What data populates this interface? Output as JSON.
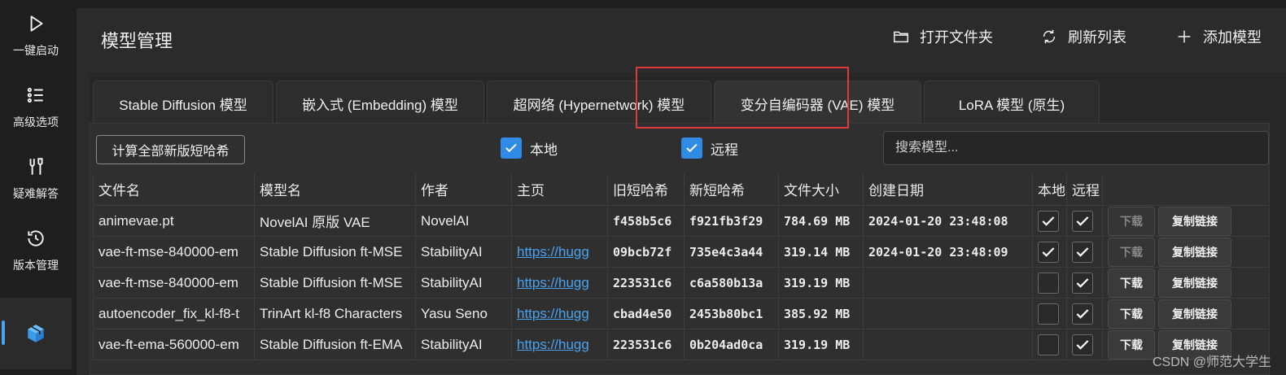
{
  "sidebar": {
    "items": [
      {
        "label": "一键启动",
        "icon": "play-icon"
      },
      {
        "label": "高级选项",
        "icon": "list-icon"
      },
      {
        "label": "疑难解答",
        "icon": "tools-icon"
      },
      {
        "label": "版本管理",
        "icon": "history-icon"
      },
      {
        "label": "",
        "icon": "cube-icon",
        "active": true
      }
    ]
  },
  "header": {
    "title": "模型管理",
    "open_folder": "打开文件夹",
    "refresh": "刷新列表",
    "add_model": "添加模型"
  },
  "tabs": [
    {
      "label": "Stable Diffusion 模型"
    },
    {
      "label": "嵌入式 (Embedding) 模型"
    },
    {
      "label": "超网络 (Hypernetwork) 模型"
    },
    {
      "label": "变分自编码器 (VAE) 模型",
      "active": true
    },
    {
      "label": "LoRA 模型 (原生)"
    }
  ],
  "toolbar": {
    "calc_button": "计算全部新版短哈希",
    "filter_local": "本地",
    "filter_remote": "远程",
    "search_placeholder": "搜索模型..."
  },
  "table": {
    "headers": [
      "文件名",
      "模型名",
      "作者",
      "主页",
      "旧短哈希",
      "新短哈希",
      "文件大小",
      "创建日期",
      "本地",
      "远程",
      ""
    ],
    "rows": [
      {
        "file": "animevae.pt",
        "model": "NovelAI 原版 VAE",
        "author": "NovelAI",
        "home": "",
        "old_hash": "f458b5c6",
        "new_hash": "f921fb3f29",
        "size": "784.69 MB",
        "date": "2024-01-20 23:48:08",
        "local": true,
        "remote": true,
        "download": "下载",
        "download_disabled": true,
        "copy": "复制链接"
      },
      {
        "file": "vae-ft-mse-840000-em",
        "model": "Stable Diffusion ft-MSE",
        "author": "StabilityAI",
        "home": "https://hugg",
        "old_hash": "09bcb72f",
        "new_hash": "735e4c3a44",
        "size": "319.14 MB",
        "date": "2024-01-20 23:48:09",
        "local": true,
        "remote": true,
        "download": "下载",
        "download_disabled": true,
        "copy": "复制链接"
      },
      {
        "file": "vae-ft-mse-840000-em",
        "model": "Stable Diffusion ft-MSE",
        "author": "StabilityAI",
        "home": "https://hugg",
        "old_hash": "223531c6",
        "new_hash": "c6a580b13a",
        "size": "319.19 MB",
        "date": "",
        "local": false,
        "remote": true,
        "download": "下载",
        "download_disabled": false,
        "copy": "复制链接"
      },
      {
        "file": "autoencoder_fix_kl-f8-t",
        "model": "TrinArt kl-f8 Characters",
        "author": "Yasu Seno",
        "home": "https://hugg",
        "old_hash": "cbad4e50",
        "new_hash": "2453b80bc1",
        "size": "385.92 MB",
        "date": "",
        "local": false,
        "remote": true,
        "download": "下载",
        "download_disabled": false,
        "copy": "复制链接"
      },
      {
        "file": "vae-ft-ema-560000-em",
        "model": "Stable Diffusion ft-EMA",
        "author": "StabilityAI",
        "home": "https://hugg",
        "old_hash": "223531c6",
        "new_hash": "0b204ad0ca",
        "size": "319.19 MB",
        "date": "",
        "local": false,
        "remote": true,
        "download": "下载",
        "download_disabled": false,
        "copy": "复制链接"
      }
    ]
  },
  "watermark": "CSDN @师范大学生",
  "colors": {
    "accent": "#2f8be6",
    "link": "#4aa3f0",
    "highlight": "#e03a3a"
  }
}
